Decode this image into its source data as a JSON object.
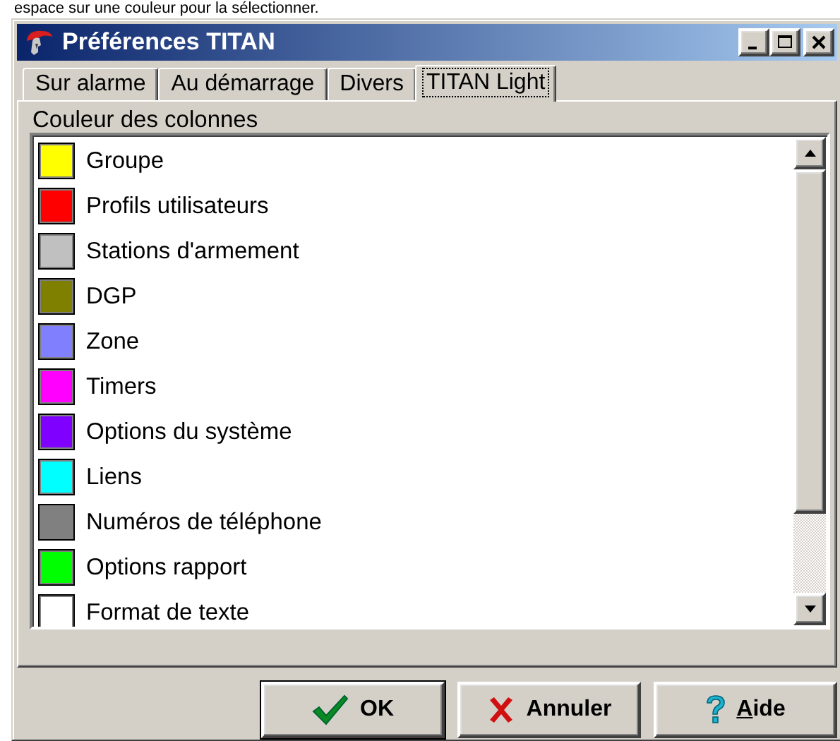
{
  "caption": "espace sur une couleur pour la sélectionner.",
  "window": {
    "title": "Préférences TITAN",
    "controls": [
      {
        "kind": "minimize"
      },
      {
        "kind": "maximize"
      },
      {
        "kind": "close"
      }
    ]
  },
  "tabs": [
    {
      "label": "Sur alarme",
      "selected": false
    },
    {
      "label": "Au démarrage",
      "selected": false
    },
    {
      "label": "Divers",
      "selected": false
    },
    {
      "label": "TITAN Light",
      "selected": true
    }
  ],
  "group_label": "Couleur des colonnes",
  "colors": [
    {
      "label": "Groupe",
      "color": "#ffff00"
    },
    {
      "label": "Profils utilisateurs",
      "color": "#ff0000"
    },
    {
      "label": "Stations d'armement",
      "color": "#c0c0c0"
    },
    {
      "label": "DGP",
      "color": "#808000"
    },
    {
      "label": "Zone",
      "color": "#8080ff"
    },
    {
      "label": "Timers",
      "color": "#ff00ff"
    },
    {
      "label": "Options du système",
      "color": "#8000ff"
    },
    {
      "label": "Liens",
      "color": "#00ffff"
    },
    {
      "label": "Numéros de téléphone",
      "color": "#808080"
    },
    {
      "label": "Options rapport",
      "color": "#00ff00"
    },
    {
      "label": "Format de texte",
      "color": "#ffffff"
    }
  ],
  "buttons": [
    {
      "kind": "ok",
      "label": "OK",
      "accelerator_underlined": false
    },
    {
      "kind": "cancel",
      "label": "Annuler",
      "accelerator_underlined": false
    },
    {
      "kind": "help",
      "label": "Aide",
      "accelerator_underlined": true
    }
  ]
}
